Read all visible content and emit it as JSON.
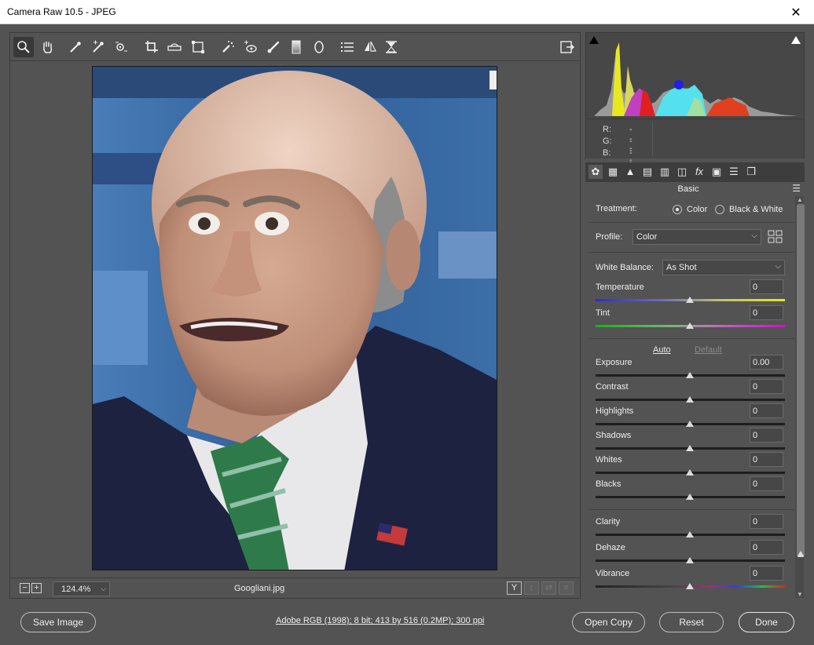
{
  "window": {
    "title": "Camera Raw 10.5  -  JPEG",
    "close_glyph": "✕"
  },
  "toolbar": {
    "tools": [
      {
        "name": "zoom-tool",
        "icon": "magnifier-icon"
      },
      {
        "name": "hand-tool",
        "icon": "hand-icon"
      },
      {
        "name": "white-balance-tool",
        "icon": "eyedropper-icon"
      },
      {
        "name": "color-sampler-tool",
        "icon": "color-sampler-icon"
      },
      {
        "name": "targeted-adjustment-tool",
        "icon": "target-adjust-icon"
      },
      {
        "name": "crop-tool",
        "icon": "crop-icon"
      },
      {
        "name": "straighten-tool",
        "icon": "straighten-icon"
      },
      {
        "name": "transform-tool",
        "icon": "transform-icon"
      },
      {
        "name": "spot-removal-tool",
        "icon": "spot-removal-icon"
      },
      {
        "name": "red-eye-tool",
        "icon": "red-eye-icon"
      },
      {
        "name": "adjustment-brush-tool",
        "icon": "brush-icon"
      },
      {
        "name": "graduated-filter-tool",
        "icon": "graduated-filter-icon"
      },
      {
        "name": "radial-filter-tool",
        "icon": "radial-filter-icon"
      },
      {
        "name": "preferences-tool",
        "icon": "list-icon"
      },
      {
        "name": "rotate-left-tool",
        "icon": "flip-icon"
      },
      {
        "name": "rotate-right-tool",
        "icon": "hourglass-icon"
      }
    ],
    "export_icon": "open-export-icon"
  },
  "status": {
    "zoom_value": "124.4%",
    "zoom_out": "−",
    "zoom_in": "+",
    "filename": "Googliani.jpg",
    "view_y": "Y",
    "view_a": "↕",
    "view_b": "⇄",
    "view_c": "≡"
  },
  "rgb": {
    "r_label": "R:",
    "g_label": "G:",
    "b_label": "B:",
    "r": "---",
    "g": "---",
    "b": "---"
  },
  "panel": {
    "name": "Basic",
    "treatment_label": "Treatment:",
    "treatment_color": "Color",
    "treatment_bw": "Black & White",
    "treatment_selected": "Color",
    "profile_label": "Profile:",
    "profile_value": "Color",
    "wb_label": "White Balance:",
    "wb_value": "As Shot",
    "auto": "Auto",
    "default": "Default",
    "sliders": [
      {
        "label": "Temperature",
        "value": "0"
      },
      {
        "label": "Tint",
        "value": "0"
      },
      {
        "label": "Exposure",
        "value": "0.00"
      },
      {
        "label": "Contrast",
        "value": "0"
      },
      {
        "label": "Highlights",
        "value": "0"
      },
      {
        "label": "Shadows",
        "value": "0"
      },
      {
        "label": "Whites",
        "value": "0"
      },
      {
        "label": "Blacks",
        "value": "0"
      },
      {
        "label": "Clarity",
        "value": "0"
      },
      {
        "label": "Dehaze",
        "value": "0"
      },
      {
        "label": "Vibrance",
        "value": "0"
      }
    ]
  },
  "bottom": {
    "save": "Save Image",
    "info": "Adobe RGB (1998); 8 bit; 413 by 516 (0.2MP); 300 ppi",
    "open_copy": "Open Copy",
    "reset": "Reset",
    "done": "Done"
  }
}
